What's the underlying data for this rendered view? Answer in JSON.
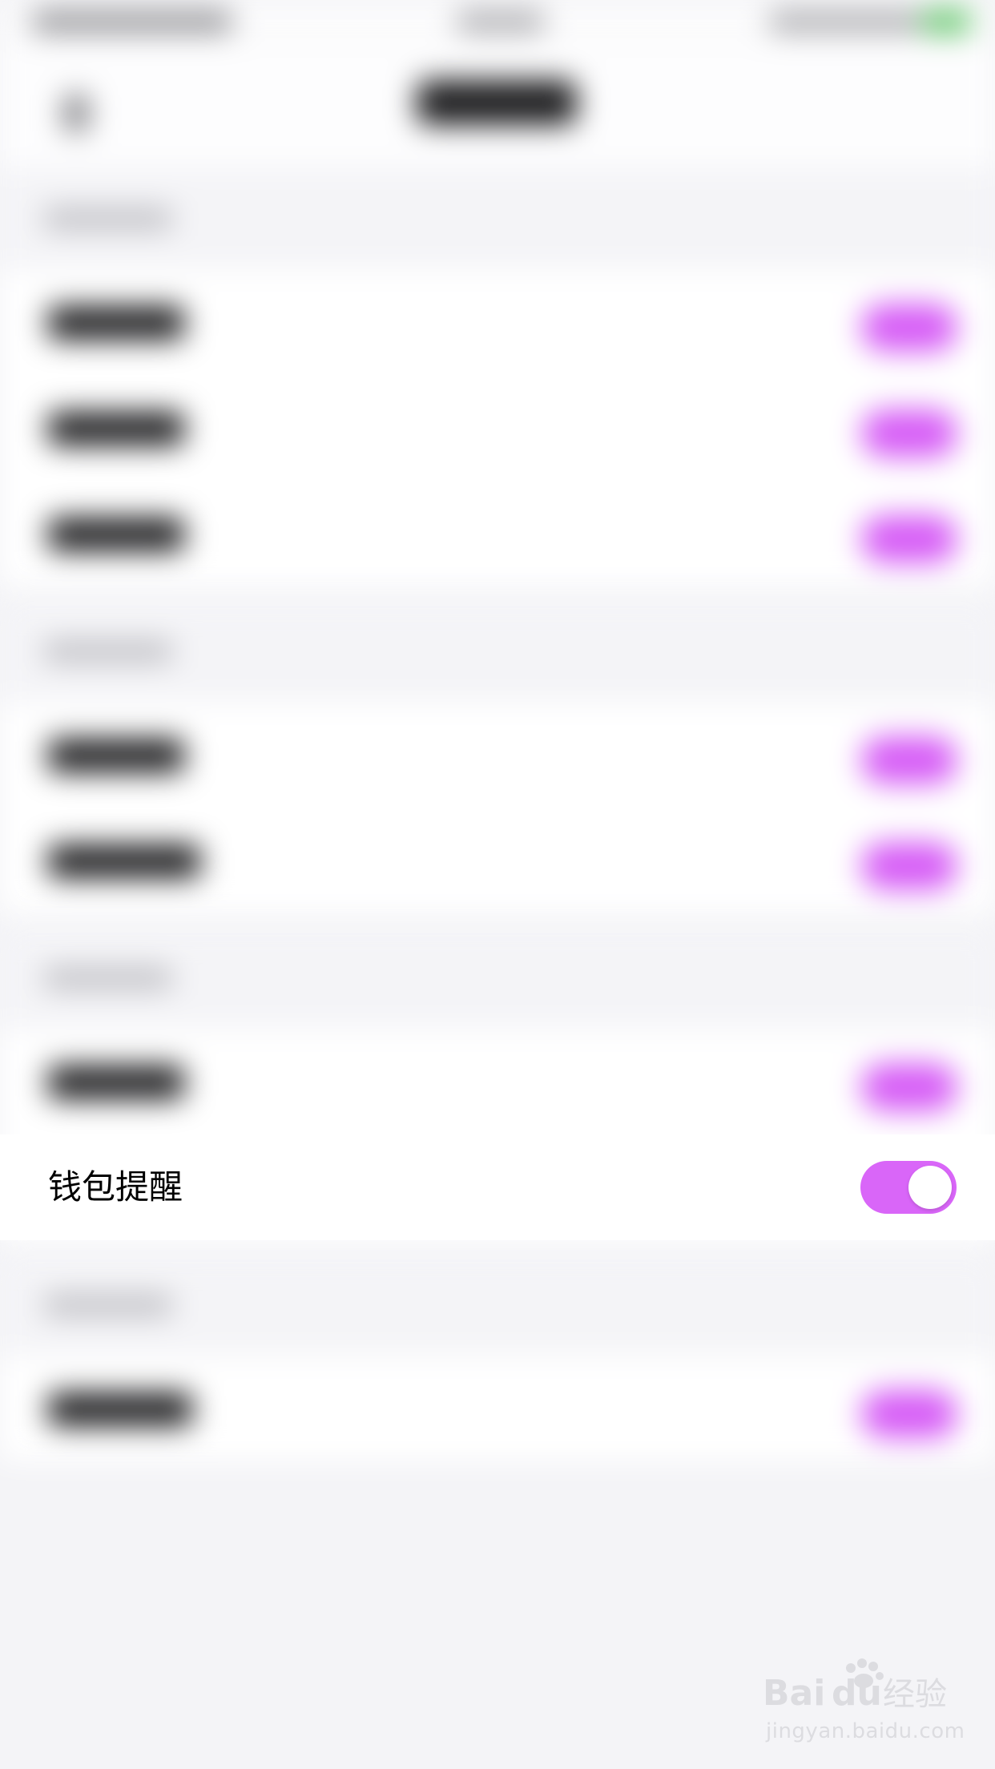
{
  "focused_row": {
    "label": "钱包提醒",
    "toggle_on": true
  },
  "colors": {
    "accent": "#d966f8",
    "background": "#f4f4f7",
    "row_bg": "#ffffff",
    "text": "#000000"
  },
  "watermark": {
    "logo_text": "Bai du 经验",
    "url": "jingyan.baidu.com"
  }
}
